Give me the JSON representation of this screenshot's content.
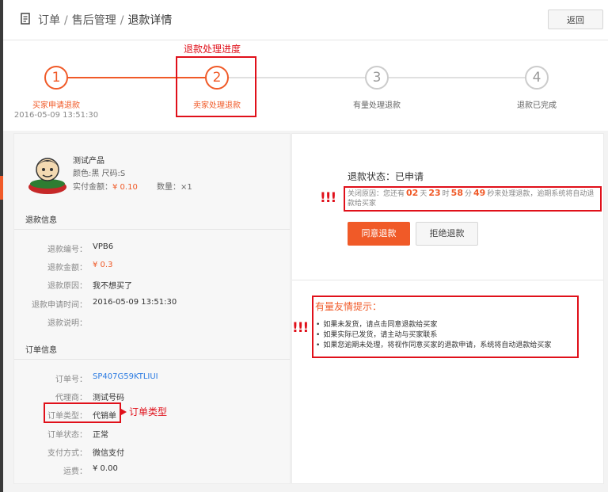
{
  "header": {
    "breadcrumb": [
      "订单",
      "售后管理",
      "退款详情"
    ],
    "back_label": "返回"
  },
  "steps": [
    {
      "num": "1",
      "label": "买家申请退款",
      "date": "2016-05-09 13:51:30",
      "state": "done"
    },
    {
      "num": "2",
      "label": "卖家处理退款",
      "state": "current"
    },
    {
      "num": "3",
      "label": "有量处理退款",
      "state": "pending"
    },
    {
      "num": "4",
      "label": "退款已完成",
      "state": "pending"
    }
  ],
  "annotations": {
    "progress_note": "退款处理进度",
    "bang": "!!!",
    "order_type_note": "订单类型"
  },
  "product": {
    "name": "测试产品",
    "spec": "颜色:黑 尺码:S",
    "amount_label": "实付金额：",
    "amount_value": "¥ 0.10",
    "qty_label": "数量：×1"
  },
  "refund_info": {
    "title": "退款信息",
    "rows": [
      {
        "label": "退款编号：",
        "value": "VPB6"
      },
      {
        "label": "退款金额：",
        "value": "¥ 0.3"
      },
      {
        "label": "退款原因：",
        "value": "我不想买了"
      },
      {
        "label": "退款申请时间：",
        "value": "2016-05-09 13:51:30"
      },
      {
        "label": "退款说明：",
        "value": ""
      }
    ]
  },
  "order_info": {
    "title": "订单信息",
    "rows": [
      {
        "label": "订单号：",
        "value": "SP407G59KTLIUI"
      },
      {
        "label": "代理商：",
        "value": "测试号码"
      },
      {
        "label": "订单类型：",
        "value": "代销单"
      },
      {
        "label": "订单状态：",
        "value": "正常"
      },
      {
        "label": "支付方式：",
        "value": "微信支付"
      },
      {
        "label": "运费：",
        "value": "¥ 0.00"
      }
    ]
  },
  "status": {
    "title": "退款状态：已申请",
    "cd_prefix": "关闭原因：您还有",
    "days": "02",
    "days_unit": "天",
    "hours": "23",
    "hours_unit": "时",
    "minutes": "58",
    "minutes_unit": "分",
    "seconds": "49",
    "seconds_unit": "秒",
    "cd_suffix": "来处理退款，逾期系统将自动退款给买家",
    "agree_label": "同意退款",
    "reject_label": "拒绝退款"
  },
  "tips": {
    "title": "有量友情提示：",
    "items": [
      "如果未发货，请点击同意退款给买家",
      "如果实际已发货，请主动与买家联系",
      "如果您逾期未处理，将视作同意买家的退款申请，系统将自动退款给买家"
    ]
  },
  "colors": {
    "accent": "#f05a28",
    "annotation": "#e0101a",
    "link": "#2a7ae2"
  }
}
